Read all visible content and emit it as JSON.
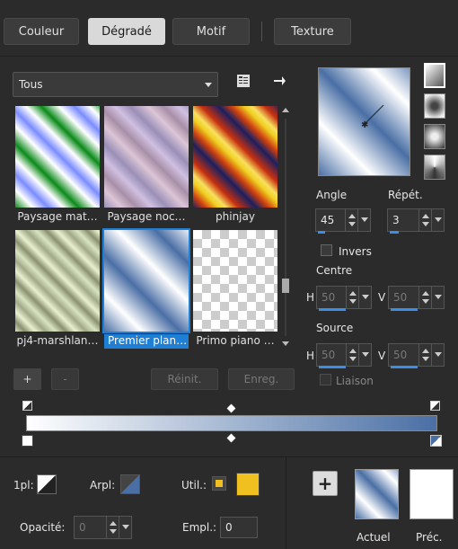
{
  "tabs": [
    {
      "label": "Couleur",
      "active": false
    },
    {
      "label": "Dégradé",
      "active": true
    },
    {
      "label": "Motif",
      "active": false
    },
    {
      "label": "Texture",
      "active": false
    }
  ],
  "category": {
    "value": "Tous"
  },
  "thumbnails": [
    {
      "caption": "Paysage mat…"
    },
    {
      "caption": "Paysage noc…"
    },
    {
      "caption": "phinjay"
    },
    {
      "caption": "pj4-marshlan…"
    },
    {
      "caption": "Premier plan…",
      "selected": true
    },
    {
      "caption": "Primo piano …"
    }
  ],
  "list_buttons": {
    "add": "+",
    "remove": "-",
    "reset": "Réinit.",
    "save": "Enreg."
  },
  "angle": {
    "label": "Angle",
    "value": "45"
  },
  "repeat": {
    "label": "Répét.",
    "value": "3"
  },
  "invert": {
    "label": "Invers",
    "checked": false
  },
  "center": {
    "label": "Centre",
    "h_label": "H",
    "h_value": "50",
    "v_label": "V",
    "v_value": "50"
  },
  "source": {
    "label": "Source",
    "h_label": "H",
    "h_value": "50",
    "v_label": "V",
    "v_value": "50"
  },
  "link": {
    "label": "Liaison",
    "checked": false
  },
  "bottom": {
    "fg_label": "1pl:",
    "bg_label": "Arpl:",
    "util_label": "Util.:",
    "opacity_label": "Opacité:",
    "opacity_value": "0",
    "location_label": "Empl.:",
    "location_value": "0",
    "add_button": "+",
    "current_label": "Actuel",
    "previous_label": "Préc."
  },
  "colors": {
    "gradient_start": "#ffffff",
    "gradient_end": "#4a6fa5",
    "util_color": "#f0c020",
    "accent": "#1f7fd4"
  }
}
